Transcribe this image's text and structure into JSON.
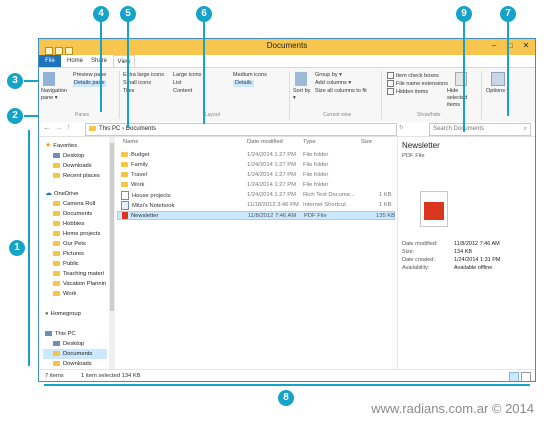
{
  "window": {
    "title": "Documents"
  },
  "tabs": [
    {
      "label": "File"
    },
    {
      "label": "Home"
    },
    {
      "label": "Share"
    },
    {
      "label": "View"
    }
  ],
  "ribbon": {
    "panes": {
      "nav_pane": "Navigation pane ▾",
      "preview_pane": "Preview pane",
      "details_pane": "Details pane",
      "group": "Panes"
    },
    "layout": {
      "items": [
        "Extra large icons",
        "Large icons",
        "Medium icons",
        "Small icons",
        "List",
        "Details",
        "Tiles",
        "Content"
      ],
      "group": "Layout"
    },
    "current_view": {
      "sort_by": "Sort by ▾",
      "group_by": "Group by ▾",
      "add_columns": "Add columns ▾",
      "size_columns": "Size all columns to fit",
      "group": "Current view"
    },
    "show_hide": {
      "item_check_boxes": "Item check boxes",
      "file_name_extensions": "File name extensions",
      "hidden_items": "Hidden items",
      "hide_selected": "Hide selected items",
      "group": "Show/hide"
    },
    "options": "Options ▾"
  },
  "address": {
    "crumbs": "This PC  ›  Documents",
    "search_placeholder": "Search Documents"
  },
  "nav": {
    "favorites": "Favorites",
    "fav_items": [
      "Desktop",
      "Downloads",
      "Recent places"
    ],
    "onedrive": "OneDrive",
    "od_items": [
      "Camera Roll",
      "Documents",
      "Hobbies",
      "Home projects",
      "Our Pets",
      "Pictures",
      "Public",
      "Teaching materi",
      "Vacation Plannin",
      "Work"
    ],
    "homegroup": "Homegroup",
    "thispc": "This PC",
    "pc_items": [
      "Desktop",
      "Documents",
      "Downloads",
      "Music"
    ]
  },
  "columns": {
    "name": "Name",
    "date": "Date modified",
    "type": "Type",
    "size": "Size"
  },
  "files": [
    {
      "name": "Budget",
      "date": "1/24/2014 1:27 PM",
      "type": "File folder",
      "size": ""
    },
    {
      "name": "Family",
      "date": "1/24/2014 1:27 PM",
      "type": "File folder",
      "size": ""
    },
    {
      "name": "Travel",
      "date": "1/24/2014 1:27 PM",
      "type": "File folder",
      "size": ""
    },
    {
      "name": "Work",
      "date": "1/24/2014 1:27 PM",
      "type": "File folder",
      "size": ""
    },
    {
      "name": "House projects",
      "date": "1/24/2014 1:27 PM",
      "type": "Rich Text Docume...",
      "size": "1 KB"
    },
    {
      "name": "Mitzi's Notebook",
      "date": "11/18/2012 3:46 PM",
      "type": "Internet Shortcut",
      "size": "1 KB"
    },
    {
      "name": "Newsletter",
      "date": "11/8/2012 7:46 AM",
      "type": "PDF File",
      "size": "135 KB"
    }
  ],
  "preview": {
    "title": "Newsletter",
    "subtitle": "PDF File",
    "props": [
      {
        "k": "Date modified:",
        "v": "11/8/2012 7:46 AM"
      },
      {
        "k": "Size:",
        "v": "134 KB"
      },
      {
        "k": "Date created:",
        "v": "1/24/2014 1:31 PM"
      },
      {
        "k": "Availability:",
        "v": "Available offline"
      }
    ]
  },
  "status": {
    "items": "7 items",
    "selected": "1 item selected  134 KB"
  },
  "callouts": [
    "1",
    "2",
    "3",
    "4",
    "5",
    "6",
    "7",
    "8",
    "9"
  ],
  "watermark": "www.radians.com.ar © 2014",
  "colors": {
    "accent": "#16a3c8",
    "title_bar": "#f8c54f",
    "file_tab": "#1e73be",
    "selection": "#cce8ff"
  }
}
